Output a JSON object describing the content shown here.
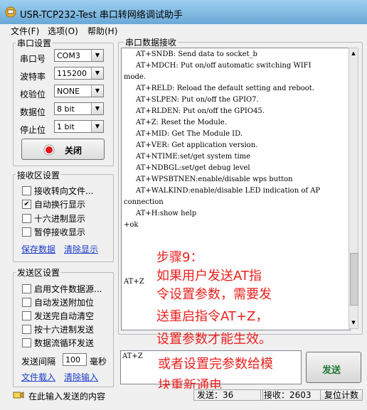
{
  "window": {
    "title": "USR-TCP232-Test 串口转网络调试助手"
  },
  "menu": [
    {
      "label": "文件(F)"
    },
    {
      "label": "选项(O)"
    },
    {
      "label": "帮助(H)"
    }
  ],
  "serial_settings": {
    "title": "串口设置",
    "port": {
      "label": "串口号",
      "value": "COM3"
    },
    "baud": {
      "label": "波特率",
      "value": "115200"
    },
    "parity": {
      "label": "校验位",
      "value": "NONE"
    },
    "databits": {
      "label": "数据位",
      "value": "8 bit"
    },
    "stopbits": {
      "label": "停止位",
      "value": "1 bit"
    },
    "close_button": "关闭"
  },
  "receive_settings": {
    "title": "接收区设置",
    "options": [
      {
        "label": "接收转向文件...",
        "checked": false
      },
      {
        "label": "自动换行显示",
        "checked": true
      },
      {
        "label": "十六进制显示",
        "checked": false
      },
      {
        "label": "暂停接收显示",
        "checked": false
      }
    ],
    "save_link": "保存数据",
    "clear_link": "清除显示"
  },
  "send_settings": {
    "title": "发送区设置",
    "options": [
      {
        "label": "启用文件数据源...",
        "checked": false
      },
      {
        "label": "自动发送附加位",
        "checked": false
      },
      {
        "label": "发送完自动清空",
        "checked": false
      },
      {
        "label": "按十六进制发送",
        "checked": false
      },
      {
        "label": "数据流循环发送",
        "checked": false
      }
    ],
    "interval_label": "发送间隔",
    "interval_value": "100",
    "interval_unit": "毫秒",
    "load_file_link": "文件载入",
    "clear_input_link": "清除输入"
  },
  "receive_area": {
    "title": "串口数据接收",
    "lines": [
      "AT+SNDB: Send data to socket_b",
      "AT+MDCH: Put on/off automatic switching WIFI",
      "mode.",
      "AT+RELD: Reload the default setting and reboot.",
      "AT+SLPEN: Put on/off the GPIO7.",
      "AT+RLDEN: Put on/off the GPIO45.",
      "AT+Z: Reset the Module.",
      "AT+MID: Get The Module ID.",
      "AT+VER: Get application version.",
      "AT+NTIME:set/get system time",
      "AT+NDBGL:set/get debug level",
      "AT+WPSBTNEN:enable/disable wps button",
      "AT+WALKIND:enable/disable LED indication of AP",
      "connection",
      "AT+H:show help",
      "+ok",
      "AT+Z"
    ]
  },
  "annotation": {
    "lines": [
      "步骤9：",
      "如果用户发送AT指",
      "令设置参数，需要发",
      "送重启指令AT+Z，",
      "设置参数才能生效。",
      "或者设置完参数给模",
      "块重新通电"
    ],
    "color": "#e8221e"
  },
  "send_area": {
    "text": "AT+Z",
    "send_button": "发送"
  },
  "status_bar": {
    "hint": "在此输入发送的内容",
    "sent": "发送：36",
    "received": "接收：2603",
    "reset_button": "复位计数"
  }
}
